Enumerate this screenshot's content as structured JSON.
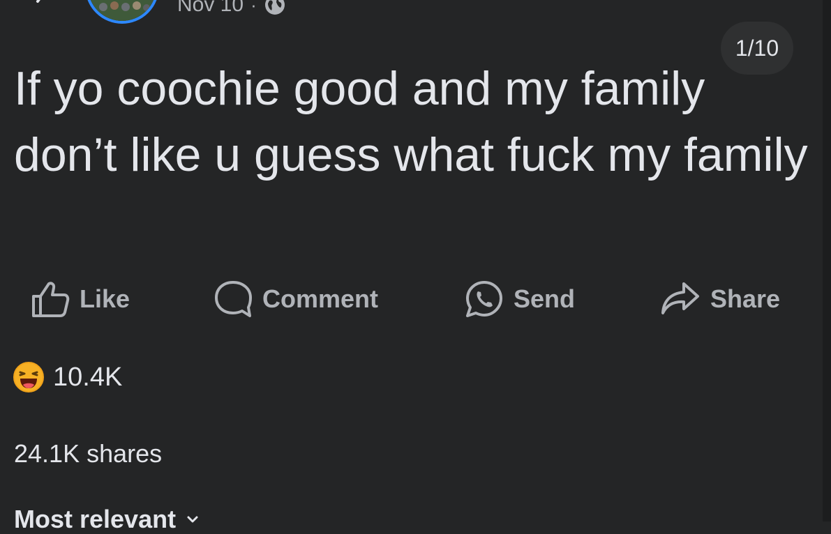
{
  "header": {
    "date": "Nov 10",
    "separator": "·",
    "privacy_icon": "globe-icon",
    "back_icon": "back-icon",
    "avatar": "profile-avatar"
  },
  "media_counter": "1/10",
  "post": {
    "text": "If yo coochie good and my family don’t like u guess what fuck my family"
  },
  "actions": [
    {
      "label": "Like",
      "icon": "thumbs-up-icon"
    },
    {
      "label": "Comment",
      "icon": "comment-icon"
    },
    {
      "label": "Send",
      "icon": "whatsapp-icon"
    },
    {
      "label": "Share",
      "icon": "share-icon"
    }
  ],
  "reactions": {
    "icon": "haha-emoji-icon",
    "count": "10.4K"
  },
  "shares": {
    "text": "24.1K shares"
  },
  "comments_sort": {
    "label": "Most relevant",
    "icon": "chevron-down-icon"
  },
  "colors": {
    "background": "#242526",
    "primary_text": "#e4e6eb",
    "secondary_text": "#b0b3b8",
    "avatar_ring": "#2d88ff",
    "emoji": "#f7b125"
  }
}
